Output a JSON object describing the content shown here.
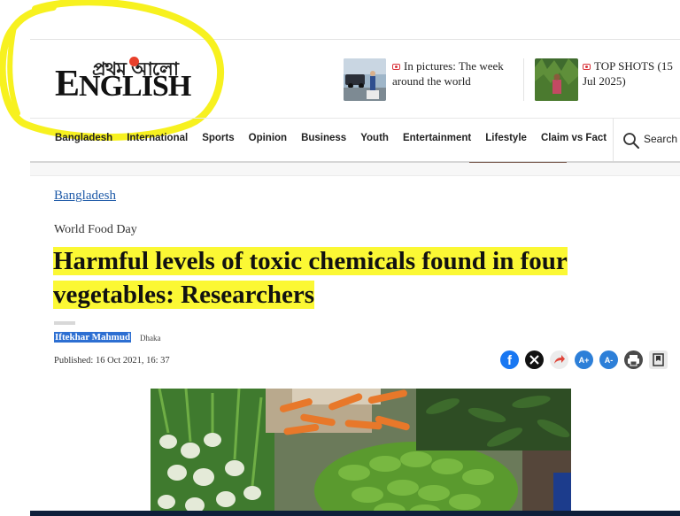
{
  "logo": {
    "bengali": "প্রথম আলো",
    "english_first": "E",
    "english_rest": "NGLISH"
  },
  "teasers": [
    {
      "label": "In pictures: The week around the world"
    },
    {
      "label": "TOP SHOTS (15 Jul 2025)"
    }
  ],
  "nav": {
    "items": [
      "Bangladesh",
      "International",
      "Sports",
      "Opinion",
      "Business",
      "Youth",
      "Entertainment",
      "Lifestyle",
      "Claim vs Fact"
    ],
    "search_label": "Search"
  },
  "article": {
    "section": "Bangladesh",
    "kicker": "World Food Day",
    "headline_part1": "Harmful levels of toxic chemicals found in four",
    "headline_part2": "vegetables: Researchers",
    "author": "Iftekhar Mahmud",
    "location": "Dhaka",
    "published": "Published: 16 Oct 2021, 16: 37"
  },
  "share_icons": [
    {
      "name": "facebook-icon",
      "color": "#1877f2",
      "glyph": "f"
    },
    {
      "name": "x-icon",
      "color": "#111111",
      "glyph": "✕"
    },
    {
      "name": "share-icon",
      "color": "#ececec",
      "glyph": "➦"
    },
    {
      "name": "font-increase-icon",
      "color": "#2d7fd8",
      "glyph": "A+"
    },
    {
      "name": "font-decrease-icon",
      "color": "#2d7fd8",
      "glyph": "A-"
    },
    {
      "name": "print-icon",
      "color": "#4a4a4a",
      "glyph": "⎙"
    },
    {
      "name": "bookmark-icon",
      "color": "#e8e8e8",
      "glyph": "⊡"
    }
  ],
  "colors": {
    "highlight": "#fbf834",
    "link": "#1e5aa8",
    "annotation_circle": "#f7f11f"
  }
}
